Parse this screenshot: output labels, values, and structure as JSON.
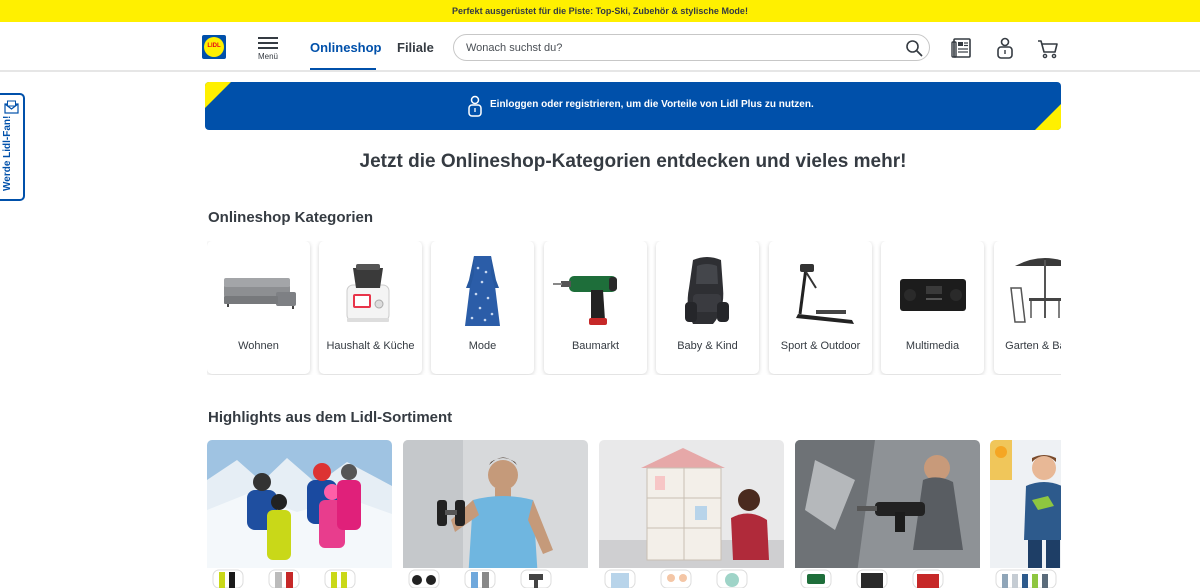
{
  "promo_bar": {
    "text": "Perfekt ausgerüstet für die Piste: Top-Ski, Zubehör & stylische Mode!"
  },
  "header": {
    "logo_text": "LIDL",
    "menu_label": "Menü",
    "tabs": [
      {
        "label": "Onlineshop",
        "active": true
      },
      {
        "label": "Filiale",
        "active": false
      }
    ],
    "search": {
      "placeholder": "Wonach suchst du?",
      "value": ""
    },
    "icons": [
      "search-icon",
      "brochure-icon",
      "account-icon",
      "cart-icon"
    ]
  },
  "side_tab": {
    "label": "Werde Lidl-Fan!"
  },
  "lidl_plus_banner": {
    "text": "Einloggen oder registrieren, um die Vorteile von Lidl Plus zu nutzen."
  },
  "main_heading": "Jetzt die Onlineshop-Kategorien entdecken und vieles mehr!",
  "categories_section": {
    "title": "Onlineshop Kategorien",
    "items": [
      {
        "label": "Wohnen"
      },
      {
        "label": "Haushalt & Küche"
      },
      {
        "label": "Mode"
      },
      {
        "label": "Baumarkt"
      },
      {
        "label": "Baby & Kind"
      },
      {
        "label": "Sport & Outdoor"
      },
      {
        "label": "Multimedia"
      },
      {
        "label": "Garten & Balkon"
      }
    ]
  },
  "highlights_section": {
    "title": "Highlights aus dem Lidl-Sortiment",
    "items": [
      {
        "subject": "ski-family"
      },
      {
        "subject": "dumbbell-fitness"
      },
      {
        "subject": "dollhouse-toys"
      },
      {
        "subject": "power-tools"
      },
      {
        "subject": "kids-clothing"
      }
    ]
  },
  "colors": {
    "lidl_blue": "#0050aa",
    "lidl_yellow": "#fff000",
    "lidl_red": "#e60a14",
    "text_dark": "#353b42"
  }
}
